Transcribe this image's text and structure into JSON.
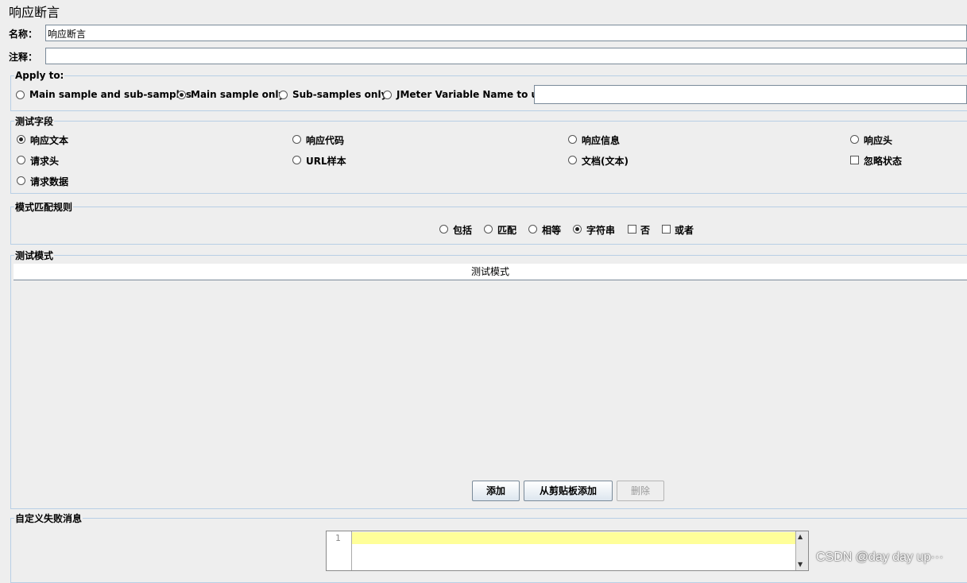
{
  "panel_title": "响应断言",
  "name": {
    "label": "名称：",
    "value": "响应断言"
  },
  "comment": {
    "label": "注释：",
    "value": ""
  },
  "apply_to": {
    "legend": "Apply to:",
    "options": [
      "Main sample and sub-samples",
      "Main sample only",
      "Sub-samples only",
      "JMeter Variable Name to use"
    ],
    "selected": "Main sample only",
    "variable_value": ""
  },
  "test_field": {
    "legend": "测试字段",
    "options": [
      "响应文本",
      "响应代码",
      "响应信息",
      "响应头",
      "请求头",
      "URL样本",
      "文档(文本)",
      "请求数据"
    ],
    "selected": "响应文本",
    "ignore_status_label": "忽略状态",
    "ignore_status_checked": false
  },
  "pattern_rules": {
    "legend": "模式匹配规则",
    "options": [
      "包括",
      "匹配",
      "相等",
      "字符串"
    ],
    "selected": "字符串",
    "not_label": "否",
    "not_checked": false,
    "or_label": "或者",
    "or_checked": false
  },
  "test_patterns": {
    "legend": "测试模式",
    "column_header": "测试模式",
    "rows": []
  },
  "buttons": {
    "add": "添加",
    "add_from_clipboard": "从剪贴板添加",
    "delete": "删除"
  },
  "custom_failure": {
    "legend": "自定义失败消息",
    "line_number": "1"
  },
  "watermark": "CSDN @day day up···"
}
